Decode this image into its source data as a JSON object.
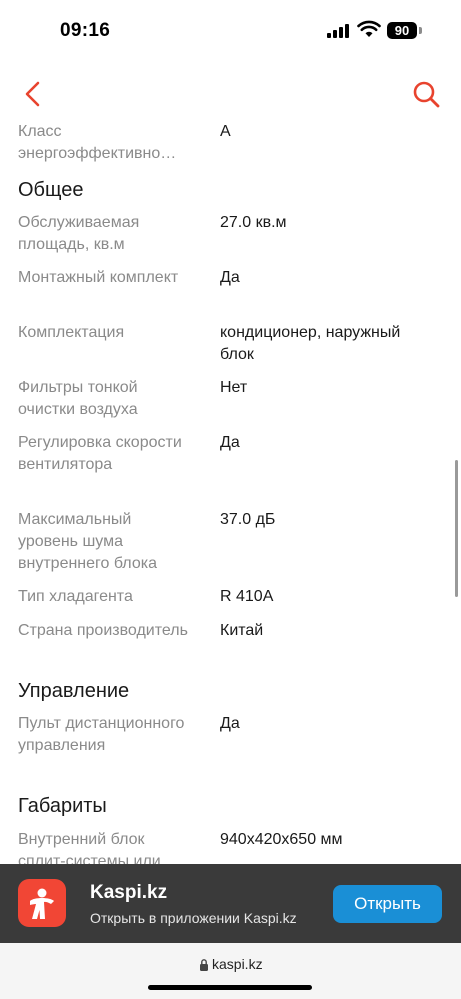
{
  "status": {
    "time": "09:16",
    "battery": "90"
  },
  "specs": {
    "partial_row": {
      "label": "Класс энергоэффективно…",
      "value": "A"
    },
    "general_title": "Общее",
    "general": [
      {
        "label": "Обслуживаемая площадь, кв.м",
        "value": "27.0 кв.м"
      },
      {
        "label": "Монтажный комплект",
        "value": "Да"
      },
      {
        "label": "Комплектация",
        "value": "кондиционер, наружный блок"
      },
      {
        "label": "Фильтры тонкой очистки воздуха",
        "value": "Нет"
      },
      {
        "label": "Регулировка скорости вентилятора",
        "value": "Да"
      },
      {
        "label": "Максимальный уровень шума внутреннего блока",
        "value": "37.0 дБ"
      },
      {
        "label": "Тип хладагента",
        "value": "R 410A"
      },
      {
        "label": "Страна производитель",
        "value": "Китай"
      }
    ],
    "control_title": "Управление",
    "control": [
      {
        "label": "Пульт дистанционного управления",
        "value": "Да"
      }
    ],
    "dimensions_title": "Габариты",
    "dimensions": [
      {
        "label": "Внутренний блок сплит-системы или",
        "value": "940x420x650 мм"
      }
    ]
  },
  "app_banner": {
    "name": "Kaspi.kz",
    "subtitle": "Открыть в приложении Kaspi.kz",
    "open_label": "Открыть",
    "brand_color": "#f14635",
    "button_color": "#1a8fd6"
  },
  "url_bar": {
    "url": "kaspi.kz"
  },
  "icons": {
    "back": "chevron-left-icon",
    "search": "search-icon",
    "lock": "lock-icon",
    "accent": "#e8432e"
  }
}
